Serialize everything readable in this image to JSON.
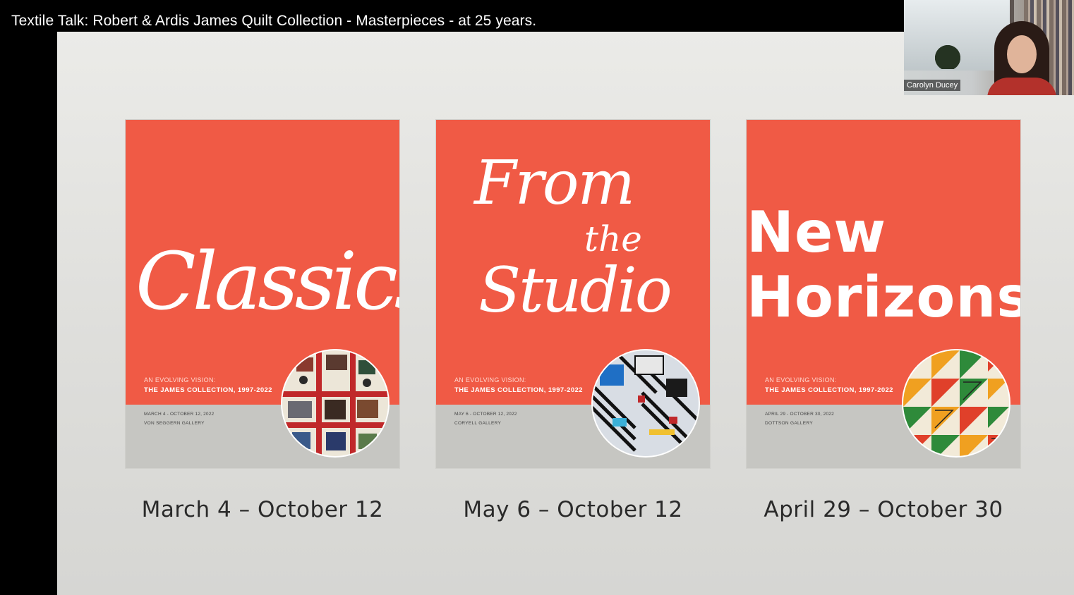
{
  "video": {
    "title": "Textile Talk: Robert & Ardis James Quilt Collection - Masterpieces - at 25 years."
  },
  "webcam": {
    "participant_name": "Carolyn Ducey"
  },
  "slide": {
    "posters": [
      {
        "title": "Classics",
        "subtitle_line1": "AN EVOLVING VISION:",
        "subtitle_line2": "THE JAMES COLLECTION, 1997-2022",
        "dates": "MARCH 4 - OCTOBER 12, 2022",
        "gallery": "VON SEGGERN GALLERY",
        "caption": "March 4 – October 12"
      },
      {
        "title_lines": [
          "From",
          "the",
          "Studio"
        ],
        "subtitle_line1": "AN EVOLVING VISION:",
        "subtitle_line2": "THE JAMES COLLECTION, 1997-2022",
        "dates": "MAY 6 - OCTOBER 12, 2022",
        "gallery": "CORYELL GALLERY",
        "caption": "May 6 – October 12"
      },
      {
        "title_lines": [
          "New",
          "Horizons"
        ],
        "subtitle_line1": "AN EVOLVING VISION:",
        "subtitle_line2": "THE JAMES COLLECTION, 1997-2022",
        "dates": "APRIL 29 - OCTOBER 30, 2022",
        "gallery": "DOTTSON GALLERY",
        "caption": "April 29 – October 30"
      }
    ]
  },
  "colors": {
    "poster_red": "#f05a45",
    "band_gray": "#c6c6c2",
    "slide_bg": "#e6e6e3"
  }
}
